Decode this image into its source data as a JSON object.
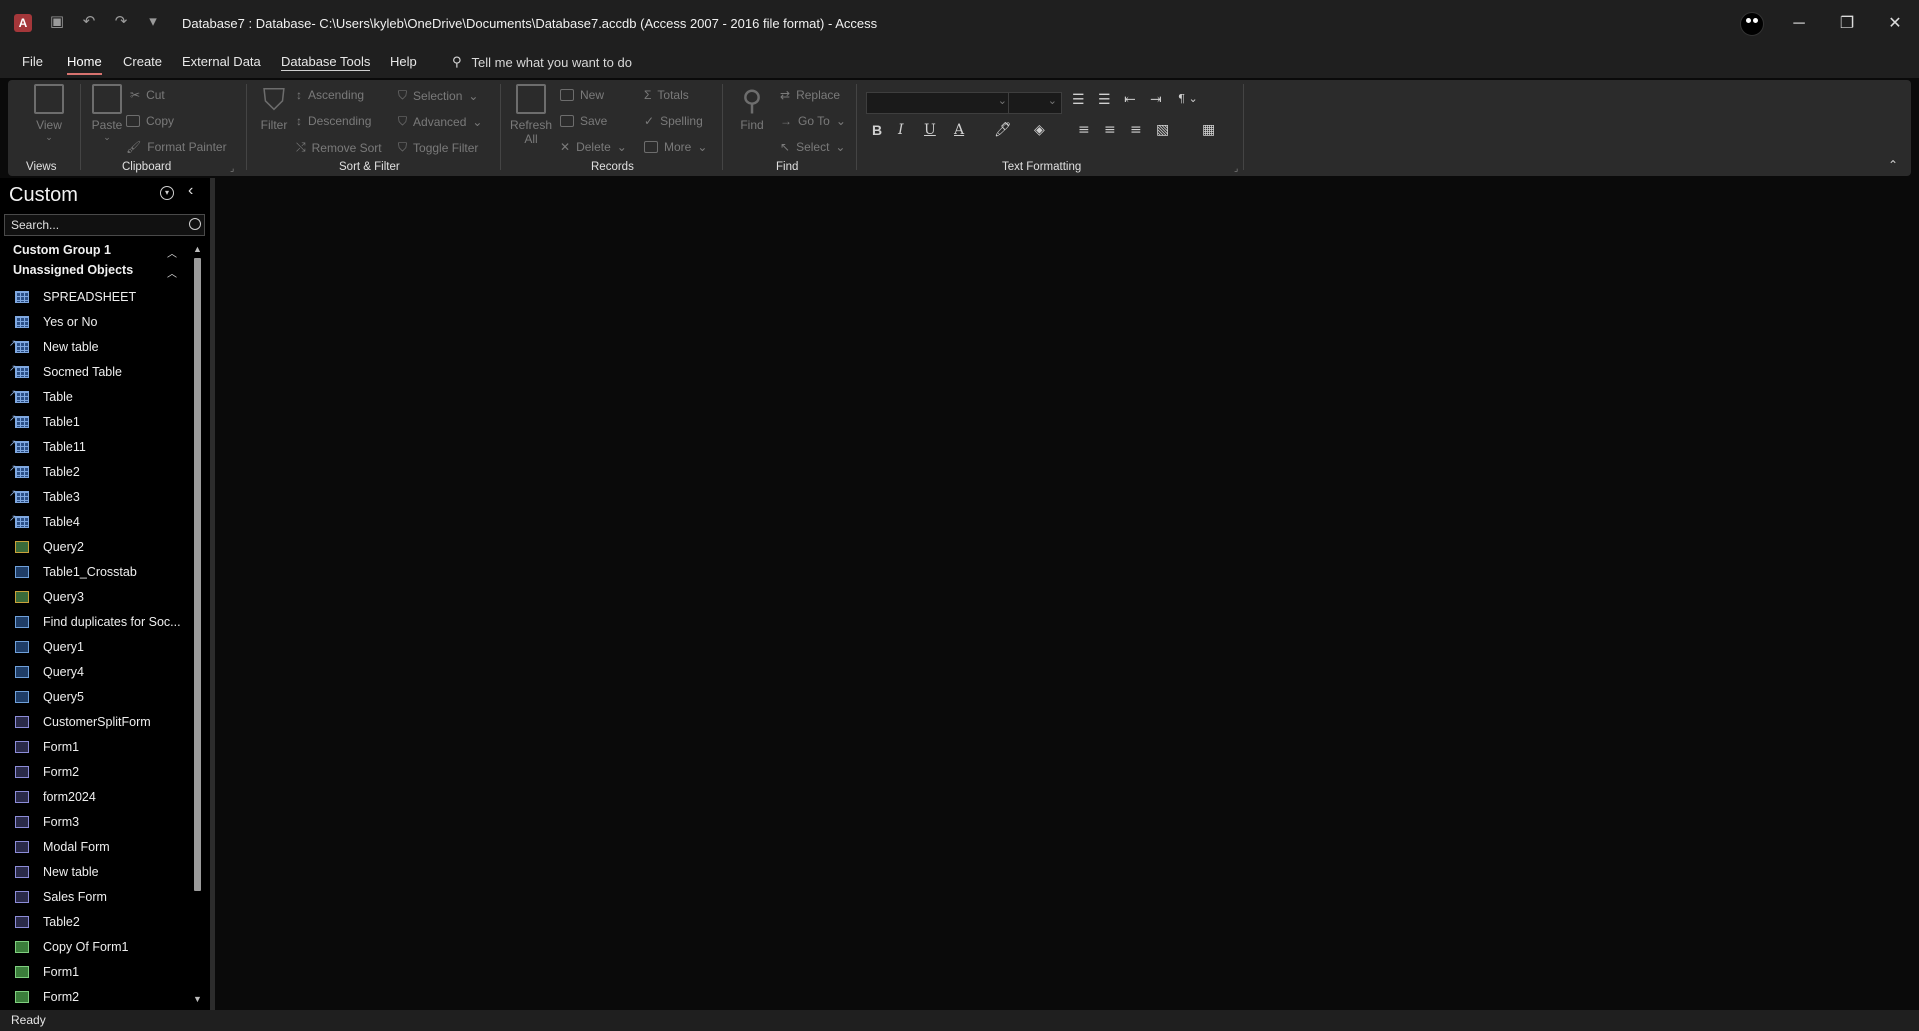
{
  "titlebar": {
    "app_icon_letter": "A",
    "title": "Database7 : Database- C:\\Users\\kyleb\\OneDrive\\Documents\\Database7.accdb (Access 2007 - 2016 file format)  -  Access",
    "qat_icons": [
      "save-icon",
      "undo-icon",
      "redo-icon",
      "customize-qat-icon"
    ],
    "window_controls": {
      "minimize": "─",
      "restore": "❐",
      "close": "✕"
    }
  },
  "tabs": [
    "File",
    "Home",
    "Create",
    "External Data",
    "Database Tools",
    "Help"
  ],
  "active_tab": "Home",
  "tellme": {
    "label": "Tell me what you want to do"
  },
  "ribbon": {
    "views": {
      "view_label": "View",
      "group_label": "Views"
    },
    "clipboard": {
      "paste_label": "Paste",
      "cut_label": "Cut",
      "copy_label": "Copy",
      "format_painter_label": "Format Painter",
      "group_label": "Clipboard"
    },
    "sort_filter": {
      "filter_label": "Filter",
      "ascending_label": "Ascending",
      "descending_label": "Descending",
      "remove_sort_label": "Remove Sort",
      "selection_label": "Selection",
      "advanced_label": "Advanced",
      "toggle_filter_label": "Toggle Filter",
      "group_label": "Sort & Filter"
    },
    "records": {
      "refresh_label": "Refresh",
      "refresh_sub_label": "All",
      "new_label": "New",
      "save_label": "Save",
      "delete_label": "Delete",
      "totals_label": "Totals",
      "spelling_label": "Spelling",
      "more_label": "More",
      "group_label": "Records"
    },
    "find": {
      "find_label": "Find",
      "replace_label": "Replace",
      "goto_label": "Go To",
      "select_label": "Select",
      "group_label": "Find"
    },
    "text_formatting": {
      "bold": "B",
      "italic": "I",
      "underline": "U",
      "font_color": "A",
      "group_label": "Text Formatting"
    }
  },
  "nav": {
    "title": "Custom",
    "search_placeholder": "Search...",
    "groups": [
      {
        "label": "Custom Group 1"
      },
      {
        "label": "Unassigned Objects"
      }
    ],
    "items": [
      {
        "label": "SPREADSHEET",
        "kind": "table",
        "linked": false
      },
      {
        "label": "Yes or No",
        "kind": "table",
        "linked": false
      },
      {
        "label": "New table",
        "kind": "table",
        "linked": true
      },
      {
        "label": "Socmed Table",
        "kind": "table",
        "linked": true
      },
      {
        "label": "Table",
        "kind": "table",
        "linked": true
      },
      {
        "label": "Table1",
        "kind": "table",
        "linked": true
      },
      {
        "label": "Table11",
        "kind": "table",
        "linked": true
      },
      {
        "label": "Table2",
        "kind": "table",
        "linked": true
      },
      {
        "label": "Table3",
        "kind": "table",
        "linked": true
      },
      {
        "label": "Table4",
        "kind": "table",
        "linked": true
      },
      {
        "label": "Query2",
        "kind": "make-table-query",
        "linked": false
      },
      {
        "label": "Table1_Crosstab",
        "kind": "crosstab-query",
        "linked": false
      },
      {
        "label": "Query3",
        "kind": "update-query",
        "linked": false
      },
      {
        "label": "Find duplicates for Soc...",
        "kind": "query",
        "linked": false
      },
      {
        "label": "Query1",
        "kind": "query",
        "linked": false
      },
      {
        "label": "Query4",
        "kind": "query",
        "linked": false
      },
      {
        "label": "Query5",
        "kind": "query",
        "linked": false
      },
      {
        "label": "CustomerSplitForm",
        "kind": "form",
        "linked": false
      },
      {
        "label": "Form1",
        "kind": "form",
        "linked": false
      },
      {
        "label": "Form2",
        "kind": "form",
        "linked": false
      },
      {
        "label": "form2024",
        "kind": "form",
        "linked": false
      },
      {
        "label": "Form3",
        "kind": "form",
        "linked": false
      },
      {
        "label": "Modal Form",
        "kind": "form",
        "linked": false
      },
      {
        "label": "New table",
        "kind": "form",
        "linked": false
      },
      {
        "label": "Sales Form",
        "kind": "form",
        "linked": false
      },
      {
        "label": "Table2",
        "kind": "form",
        "linked": false
      },
      {
        "label": "Copy Of Form1",
        "kind": "report",
        "linked": false
      },
      {
        "label": "Form1",
        "kind": "report",
        "linked": false
      },
      {
        "label": "Form2",
        "kind": "report",
        "linked": false
      }
    ]
  },
  "status": {
    "text": "Ready"
  }
}
